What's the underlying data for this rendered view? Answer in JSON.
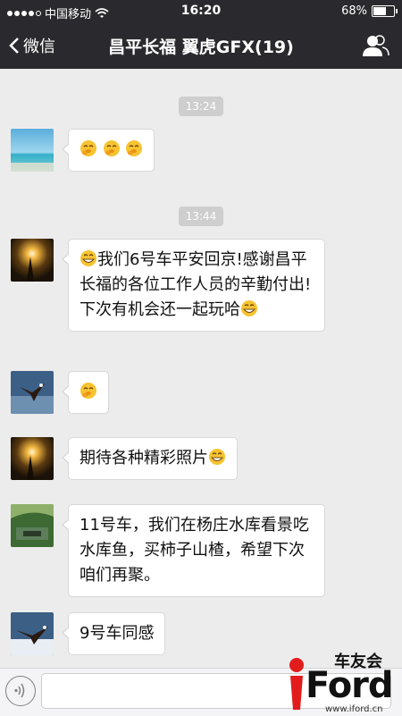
{
  "status_bar": {
    "carrier": "中国移动",
    "time": "16:20",
    "battery": "68%",
    "battery_level": 0.68
  },
  "nav": {
    "back_label": "微信",
    "title": "昌平长福 翼虎GFX(19)",
    "group_icon": "group-info-icon"
  },
  "timestamps": [
    "13:24",
    "13:44"
  ],
  "messages": [
    {
      "avatar": "sea-avatar",
      "text": "",
      "emoji_count": 3
    },
    {
      "avatar": "sunset-avatar",
      "text": "我们6号车平安回京!感谢昌平长福的各位工作人员的辛勤付出! 下次有机会还一起玩哈"
    },
    {
      "avatar": "eagle-avatar",
      "text": "",
      "emoji_count": 1
    },
    {
      "avatar": "sunset-avatar",
      "text": "期待各种精彩照片"
    },
    {
      "avatar": "landscape-avatar",
      "text": "11号车，我们在杨庄水库看景吃水库鱼，买柿子山楂，希望下次咱们再聚。"
    },
    {
      "avatar": "eagle-avatar",
      "text": "9号车同感"
    }
  ],
  "input_bar": {
    "voice_icon": "voice-icon",
    "placeholder": ""
  },
  "watermark": {
    "top": "车友会",
    "logo": "Ford",
    "url": "www.iford.cn"
  },
  "colors": {
    "header": "#2a2a2e",
    "background": "#ececec",
    "bubble": "#ffffff",
    "watermark_red": "#e21c1c"
  }
}
